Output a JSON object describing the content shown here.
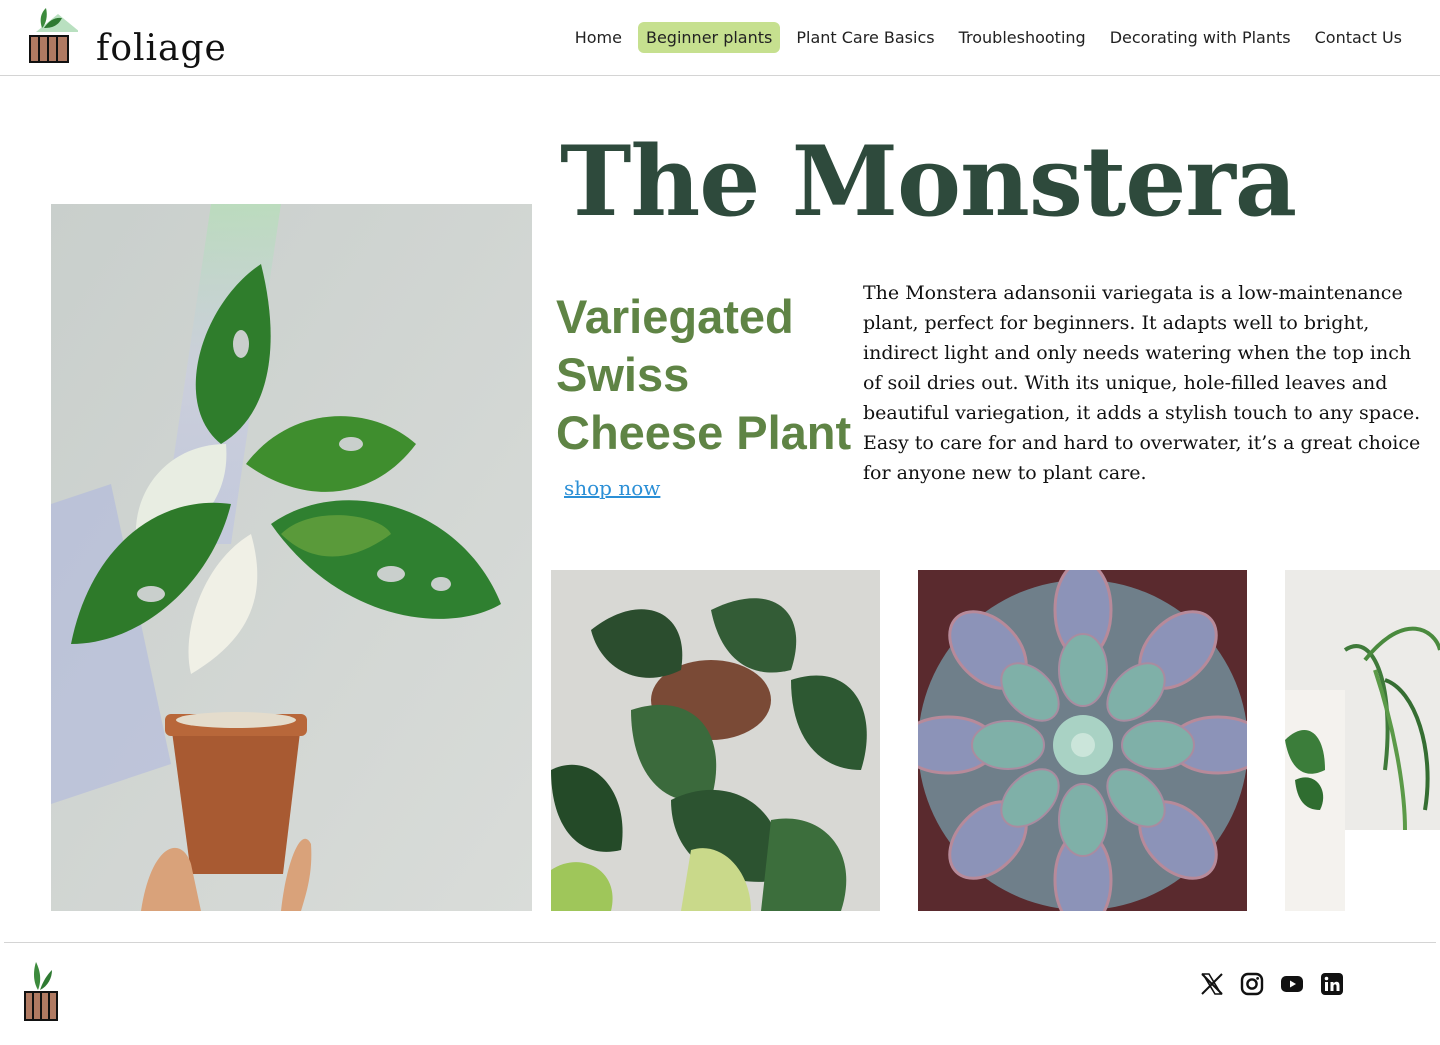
{
  "brand": {
    "name": "foliage"
  },
  "nav": {
    "items": [
      {
        "label": "Home"
      },
      {
        "label": "Beginner plants",
        "active": true
      },
      {
        "label": "Plant Care Basics"
      },
      {
        "label": "Troubleshooting"
      },
      {
        "label": "Decorating with Plants"
      },
      {
        "label": "Contact Us"
      }
    ]
  },
  "hero": {
    "title": "The Monstera",
    "subtitle": "Variegated Swiss Cheese Plant",
    "cta_label": "shop now",
    "description": "The Monstera adansonii variegata is a low-maintenance plant, perfect for beginners. It adapts well to bright, indirect light and only needs watering when the top inch of soil dries out. With its unique, hole-filled leaves and beautiful variegation, it adds a stylish touch to any space. Easy to care for and hard to overwater, it’s a great choice for anyone new to plant care."
  },
  "gallery": [
    "monstera-photo",
    "philodendron-photo",
    "succulent-photo",
    "spider-plant-photo"
  ],
  "footer": {
    "social": [
      "x-icon",
      "instagram-icon",
      "youtube-icon",
      "linkedin-icon"
    ]
  },
  "colors": {
    "title": "#2e4a3c",
    "subtitle": "#5f8445",
    "nav_active": "#c6e08f",
    "link": "#2b8fd6"
  }
}
